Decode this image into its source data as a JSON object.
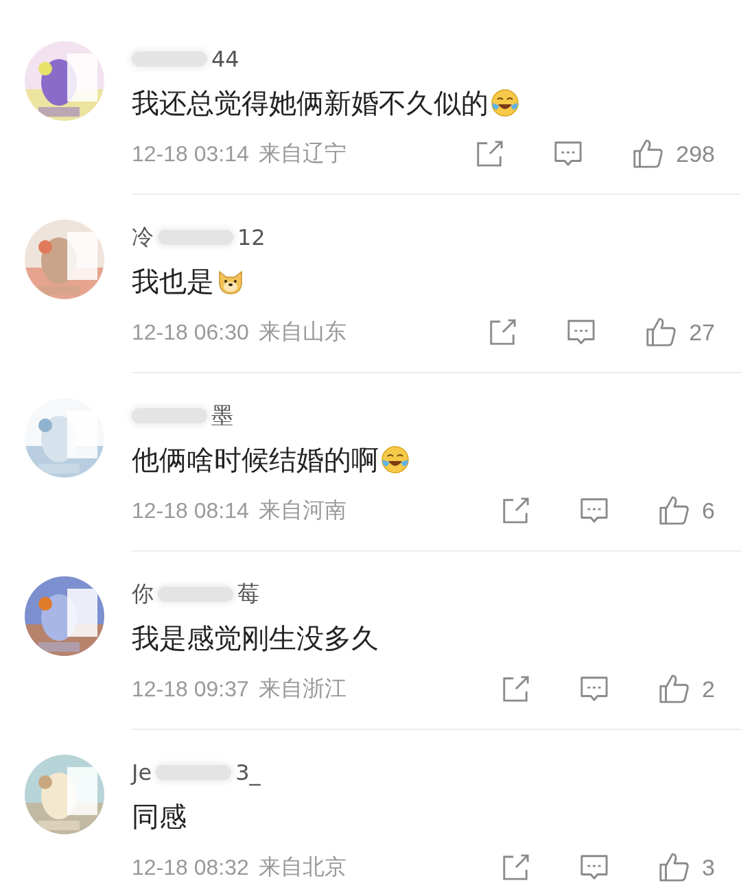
{
  "comments": [
    {
      "kind": "laughing-emoji",
      "name_parts": [
        "44"
      ],
      "text": "我还总觉得她俩新婚不久似的",
      "time": "12-18 03:14",
      "location": "来自辽宁",
      "likes": "298"
    },
    {
      "kind": "dog-emoji",
      "name_parts": [
        "冷",
        "12"
      ],
      "text": "我也是",
      "time": "12-18 06:30",
      "location": "来自山东",
      "likes": "27"
    },
    {
      "kind": "laughing-emoji",
      "name_parts": [
        "墨"
      ],
      "text": "他俩啥时候结婚的啊",
      "time": "12-18 08:14",
      "location": "来自河南",
      "likes": "6"
    },
    {
      "kind": "plain",
      "name_parts": [
        "你",
        "莓"
      ],
      "text": "我是感觉刚生没多久",
      "time": "12-18 09:37",
      "location": "来自浙江",
      "likes": "2"
    },
    {
      "kind": "plain",
      "name_parts": [
        "Je",
        "3_"
      ],
      "text": "同感",
      "time": "12-18 08:32",
      "location": "来自北京",
      "likes": "3"
    }
  ]
}
